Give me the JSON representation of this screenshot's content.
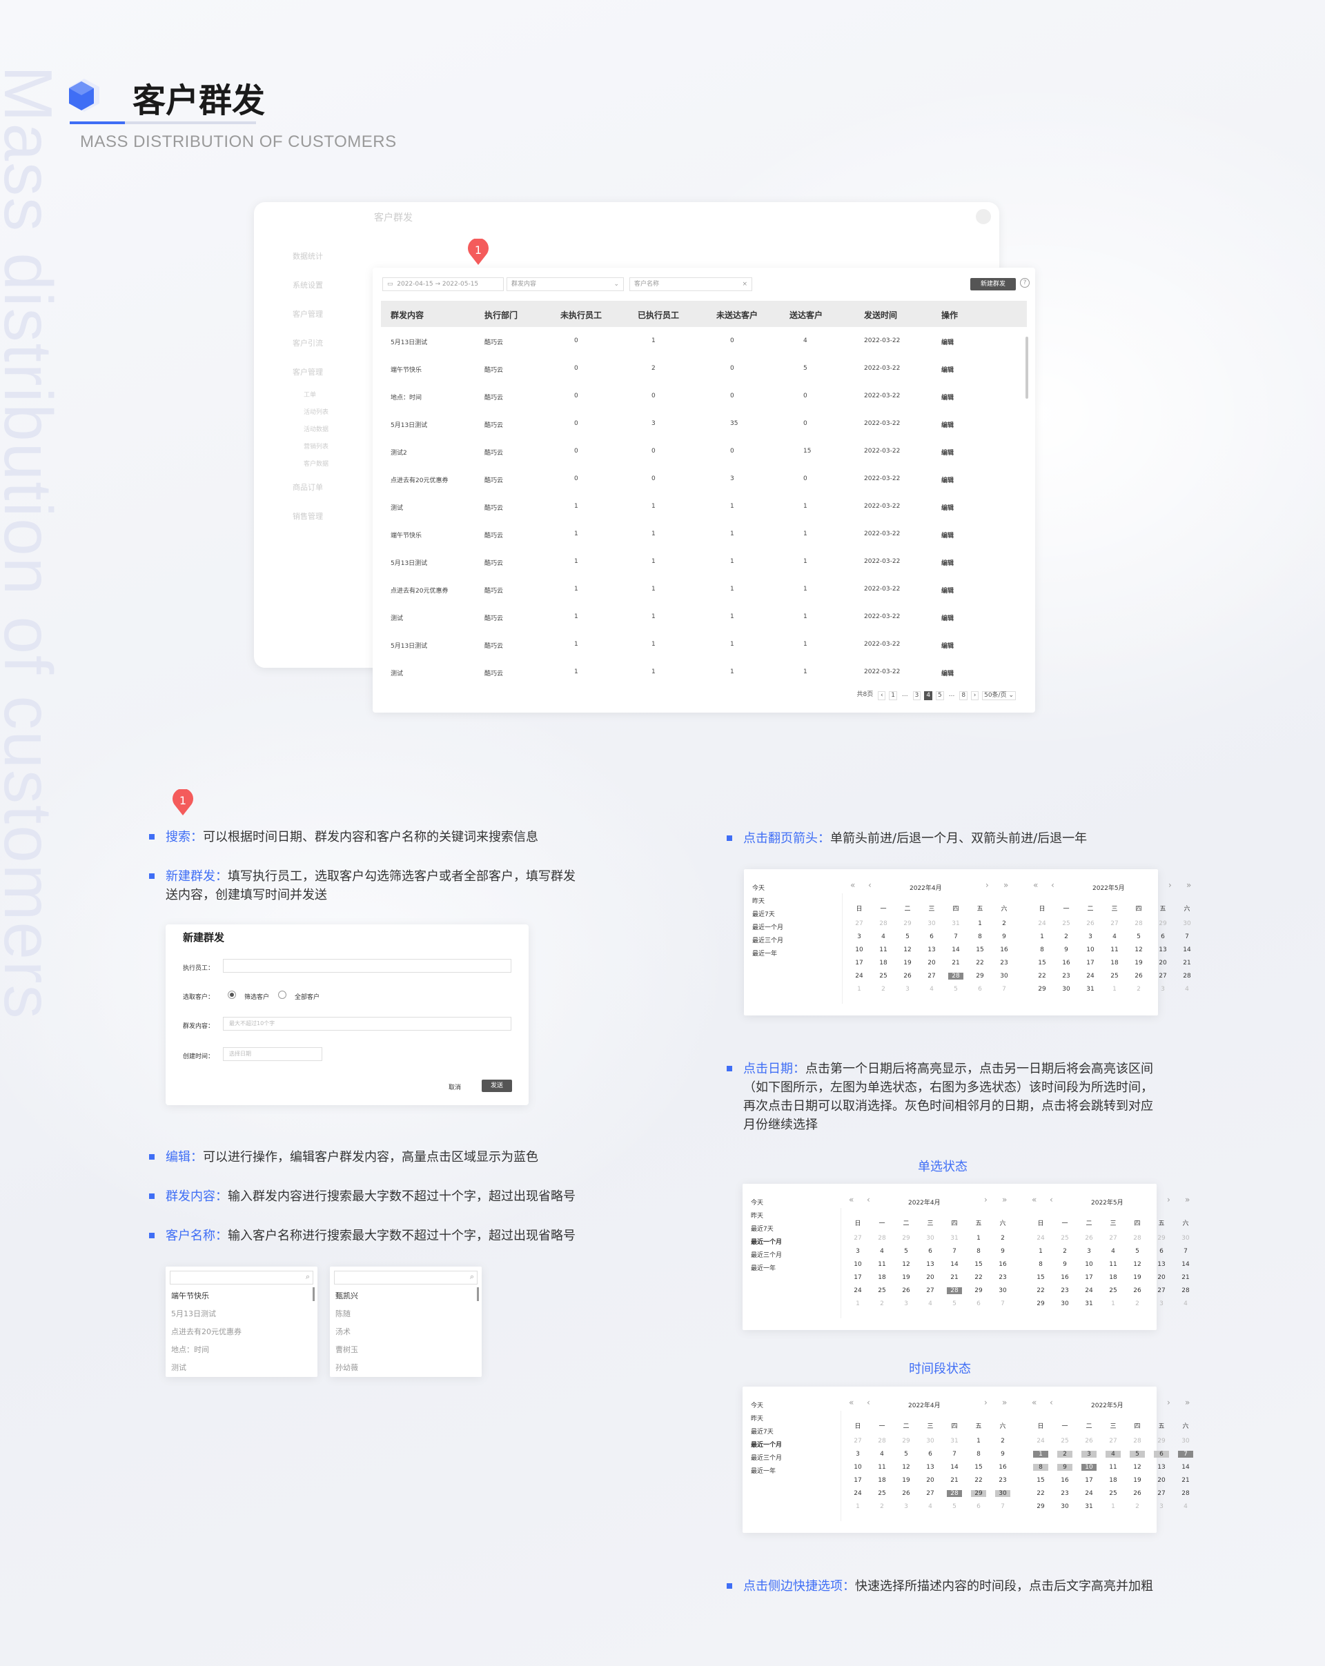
{
  "page": {
    "vertical_text": "Mass distribution of customers",
    "title": "客户群发",
    "subtitle": "MASS DISTRIBUTION OF CUSTOMERS",
    "brand_color": "#3f6ef5",
    "badge": "1"
  },
  "back_window": {
    "title": "客户群发",
    "sidebar": [
      "数据统计",
      "系统设置",
      "客户管理",
      "客户引流",
      "客户管理",
      "工单",
      "活动列表",
      "活动数据",
      "营销列表",
      "客户数据",
      "商品订单",
      "销售管理"
    ]
  },
  "toolbar": {
    "date_from": "2022-04-15",
    "date_arrow": "→",
    "date_to": "2022-05-15",
    "content_placeholder": "群发内容",
    "name_placeholder": "客户名称",
    "new_button": "新建群发"
  },
  "table": {
    "columns": [
      "群发内容",
      "执行部门",
      "未执行员工",
      "已执行员工",
      "未送达客户",
      "送达客户",
      "发送时间",
      "操作"
    ],
    "rows": [
      [
        "5月13日测试",
        "酷巧云",
        "0",
        "1",
        "0",
        "4",
        "2022-03-22",
        "编辑"
      ],
      [
        "端午节快乐",
        "酷巧云",
        "0",
        "2",
        "0",
        "5",
        "2022-03-22",
        "编辑"
      ],
      [
        "地点：时间",
        "酷巧云",
        "0",
        "0",
        "0",
        "0",
        "2022-03-22",
        "编辑"
      ],
      [
        "5月13日测试",
        "酷巧云",
        "0",
        "3",
        "35",
        "0",
        "2022-03-22",
        "编辑"
      ],
      [
        "测试2",
        "酷巧云",
        "0",
        "0",
        "0",
        "15",
        "2022-03-22",
        "编辑"
      ],
      [
        "点进去有20元优惠券",
        "酷巧云",
        "0",
        "0",
        "3",
        "0",
        "2022-03-22",
        "编辑"
      ],
      [
        "测试",
        "酷巧云",
        "1",
        "1",
        "1",
        "1",
        "2022-03-22",
        "编辑"
      ],
      [
        "端午节快乐",
        "酷巧云",
        "1",
        "1",
        "1",
        "1",
        "2022-03-22",
        "编辑"
      ],
      [
        "5月13日测试",
        "酷巧云",
        "1",
        "1",
        "1",
        "1",
        "2022-03-22",
        "编辑"
      ],
      [
        "点进去有20元优惠券",
        "酷巧云",
        "1",
        "1",
        "1",
        "1",
        "2022-03-22",
        "编辑"
      ],
      [
        "测试",
        "酷巧云",
        "1",
        "1",
        "1",
        "1",
        "2022-03-22",
        "编辑"
      ],
      [
        "5月13日测试",
        "酷巧云",
        "1",
        "1",
        "1",
        "1",
        "2022-03-22",
        "编辑"
      ],
      [
        "测试",
        "酷巧云",
        "1",
        "1",
        "1",
        "1",
        "2022-03-22",
        "编辑"
      ]
    ]
  },
  "pagination": {
    "total": "共8页",
    "prev": "‹",
    "next": "›",
    "pages": [
      "1",
      "...",
      "3",
      "4",
      "5",
      "...",
      "8"
    ],
    "current": "4",
    "page_size": "50条/页 ⌄"
  },
  "bullets": {
    "search": {
      "key": "搜索：",
      "text": "可以根据时间日期、群发内容和客户名称的关键词来搜索信息"
    },
    "new": {
      "key": "新建群发：",
      "text": "填写执行员工，选取客户勾选筛选客户或者全部客户，填写群发",
      "text2": "送内容，创建填写时间并发送"
    },
    "edit": {
      "key": "编辑：",
      "text": "可以进行操作，编辑客户群发内容，高量点击区域显示为蓝色"
    },
    "content": {
      "key": "群发内容：",
      "text": "输入群发内容进行搜索最大字数不超过十个字，超过出现省略号"
    },
    "name": {
      "key": "客户名称：",
      "text": "输入客户名称进行搜索最大字数不超过十个字，超过出现省略号"
    },
    "pager": {
      "key": "点击翻页箭头：",
      "text": "单箭头前进/后退一个月、双箭头前进/后退一年"
    },
    "date": {
      "key": "点击日期：",
      "text": "点击第一个日期后将高亮显示，点击另一日期后将会高亮该区间",
      "line2": "（如下图所示，左图为单选状态，右图为多选状态）该时间段为所选时间，",
      "line3": "再次点击日期可以取消选择。灰色时间相邻月的日期，点击将会跳转到对应",
      "line4": "月份继续选择"
    },
    "quick": {
      "key": "点击侧边快捷选项：",
      "text": "快速选择所描述内容的时间段，点击后文字高亮并加粗"
    }
  },
  "dialog": {
    "title": "新建群发",
    "executor_label": "执行员工：",
    "select_label": "选取客户：",
    "opt1": "筛选客户",
    "opt2": "全部客户",
    "content_label": "群发内容：",
    "content_placeholder": "最大不超过10个字",
    "time_label": "创建时间：",
    "time_placeholder": "选择日期",
    "cancel": "取消",
    "send": "发送"
  },
  "list1": [
    "端午节快乐",
    "5月13日测试",
    "点进去有20元优惠券",
    "地点：时间",
    "测试"
  ],
  "list2": [
    "甄凯兴",
    "陈随",
    "汤术",
    "曹树玉",
    "孙幼薇"
  ],
  "calendar": {
    "quick": [
      "今天",
      "昨天",
      "最近7天",
      "最近一个月",
      "最近三个月",
      "最近一年"
    ],
    "weekdays": [
      "日",
      "一",
      "二",
      "三",
      "四",
      "五",
      "六"
    ],
    "month1": "2022年4月",
    "month2": "2022年5月",
    "nav_dbl_left": "«",
    "nav_left": "‹",
    "nav_right": "›",
    "nav_dbl_right": "»",
    "apr": [
      "27",
      "28",
      "29",
      "30",
      "31",
      "1",
      "2",
      "3",
      "4",
      "5",
      "6",
      "7",
      "8",
      "9",
      "10",
      "11",
      "12",
      "13",
      "14",
      "15",
      "16",
      "17",
      "18",
      "19",
      "20",
      "21",
      "22",
      "23",
      "24",
      "25",
      "26",
      "27",
      "28",
      "29",
      "30",
      "1",
      "2",
      "3",
      "4",
      "5",
      "6",
      "7"
    ],
    "may": [
      "24",
      "25",
      "26",
      "27",
      "28",
      "29",
      "30",
      "1",
      "2",
      "3",
      "4",
      "5",
      "6",
      "7",
      "8",
      "9",
      "10",
      "11",
      "12",
      "13",
      "14",
      "15",
      "16",
      "17",
      "18",
      "19",
      "20",
      "21",
      "22",
      "23",
      "24",
      "25",
      "26",
      "27",
      "28",
      "29",
      "30",
      "31",
      "1",
      "2",
      "3",
      "4"
    ],
    "single_title": "单选状态",
    "range_title": "时间段状态"
  }
}
